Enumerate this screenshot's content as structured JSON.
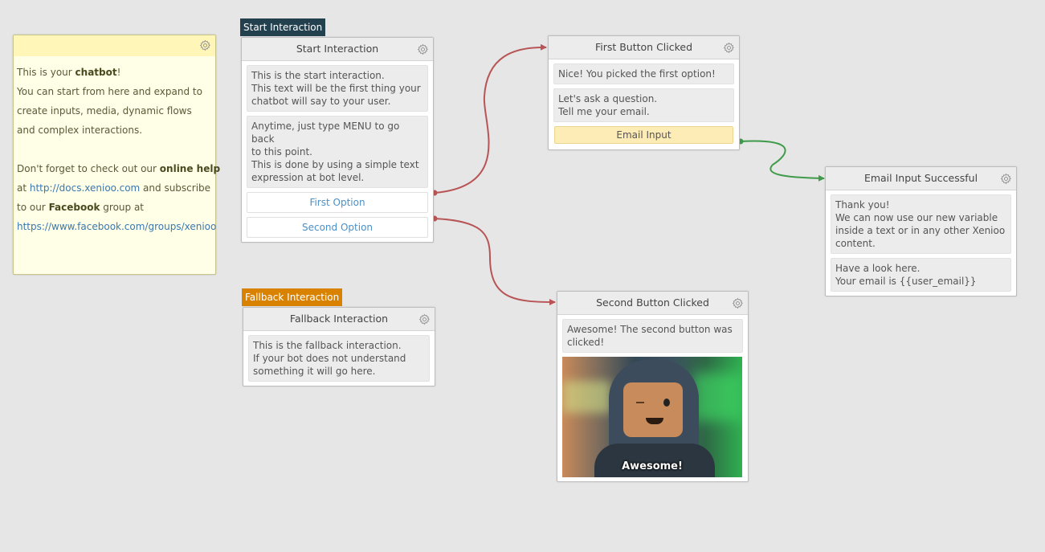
{
  "colors": {
    "background": "#e6e6e6",
    "start_tag": "#23404f",
    "fallback_tag": "#d98200",
    "link_button": "#b85455",
    "link_input": "#3f9b4a",
    "note_bg": "#fffee6",
    "input_button_bg": "#fdecb6"
  },
  "note": {
    "icon": "gear-icon",
    "lines": [
      {
        "parts": [
          {
            "t": "This is your "
          },
          {
            "t": "chatbot",
            "b": true
          },
          {
            "t": "!"
          }
        ]
      },
      {
        "parts": [
          {
            "t": "You can start from here and expand to"
          }
        ]
      },
      {
        "parts": [
          {
            "t": "create inputs, media, dynamic flows"
          }
        ]
      },
      {
        "parts": [
          {
            "t": "and complex interactions."
          }
        ]
      },
      {
        "parts": [
          {
            "t": " "
          }
        ]
      },
      {
        "parts": [
          {
            "t": "Don't forget to check out our "
          },
          {
            "t": "online help",
            "b": true
          }
        ]
      },
      {
        "parts": [
          {
            "t": "at "
          },
          {
            "t": "http://docs.xenioo.com",
            "l": true
          },
          {
            "t": " and subscribe"
          }
        ]
      },
      {
        "parts": [
          {
            "t": "to our "
          },
          {
            "t": "Facebook",
            "b": true
          },
          {
            "t": " group at"
          }
        ]
      },
      {
        "parts": [
          {
            "t": "https://www.facebook.com/groups/xenioo",
            "l": true
          }
        ]
      }
    ]
  },
  "tags": {
    "start": "Start Interaction",
    "fallback": "Fallback Interaction"
  },
  "nodes": {
    "start": {
      "title": "Start Interaction",
      "messages": [
        "This is the start interaction.\nThis text will be the first thing your\nchatbot will say to your user.",
        "Anytime, just type MENU to go back\nto this point.\nThis is done by using a simple text\nexpression at bot level."
      ],
      "buttons": [
        "First Option",
        "Second Option"
      ]
    },
    "fallback": {
      "title": "Fallback Interaction",
      "messages": [
        "This is the fallback interaction.\nIf your bot does not understand\nsomething it will go here."
      ]
    },
    "first": {
      "title": "First Button Clicked",
      "messages": [
        "Nice! You picked the first option!",
        "Let's ask a question.\nTell me your email."
      ],
      "input_button": "Email Input"
    },
    "second": {
      "title": "Second Button Clicked",
      "messages": [
        "Awesome! The second button was\nclicked!"
      ],
      "image_caption": "Awesome!"
    },
    "email": {
      "title": "Email Input Successful",
      "messages": [
        "Thank you!\nWe can now use our new variable\ninside a text or in any other Xenioo\ncontent.",
        "Have a look here.\nYour email is {{user_email}}"
      ]
    }
  },
  "links": [
    {
      "from": "start.buttons.0",
      "to": "first",
      "kind": "button"
    },
    {
      "from": "start.buttons.1",
      "to": "second",
      "kind": "button"
    },
    {
      "from": "first.input_button",
      "to": "email",
      "kind": "input"
    }
  ]
}
